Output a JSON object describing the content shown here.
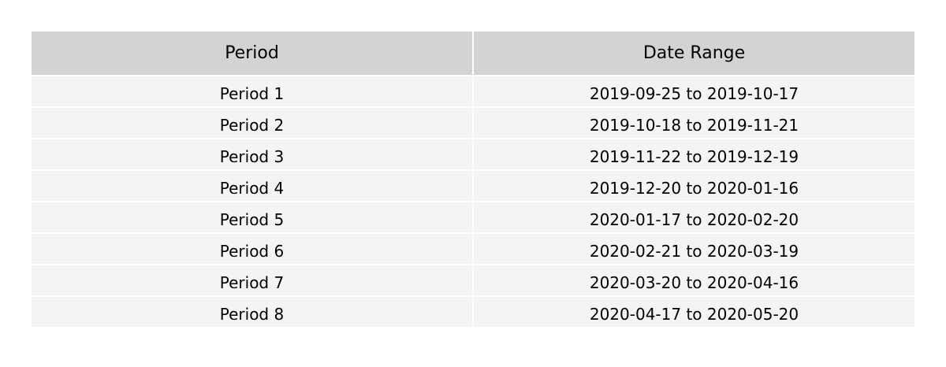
{
  "chart_data": {
    "type": "table",
    "columns": [
      "Period",
      "Date Range"
    ],
    "rows": [
      [
        "Period 1",
        "2019-09-25 to 2019-10-17"
      ],
      [
        "Period 2",
        "2019-10-18 to 2019-11-21"
      ],
      [
        "Period 3",
        "2019-11-22 to 2019-12-19"
      ],
      [
        "Period 4",
        "2019-12-20 to 2020-01-16"
      ],
      [
        "Period 5",
        "2020-01-17 to 2020-02-20"
      ],
      [
        "Period 6",
        "2020-02-21 to 2020-03-19"
      ],
      [
        "Period 7",
        "2020-03-20 to 2020-04-16"
      ],
      [
        "Period 8",
        "2020-04-17 to 2020-05-20"
      ]
    ],
    "colors": {
      "header_background": "#d3d3d3",
      "row_background": "#f4f4f4",
      "text": "#000000"
    }
  }
}
